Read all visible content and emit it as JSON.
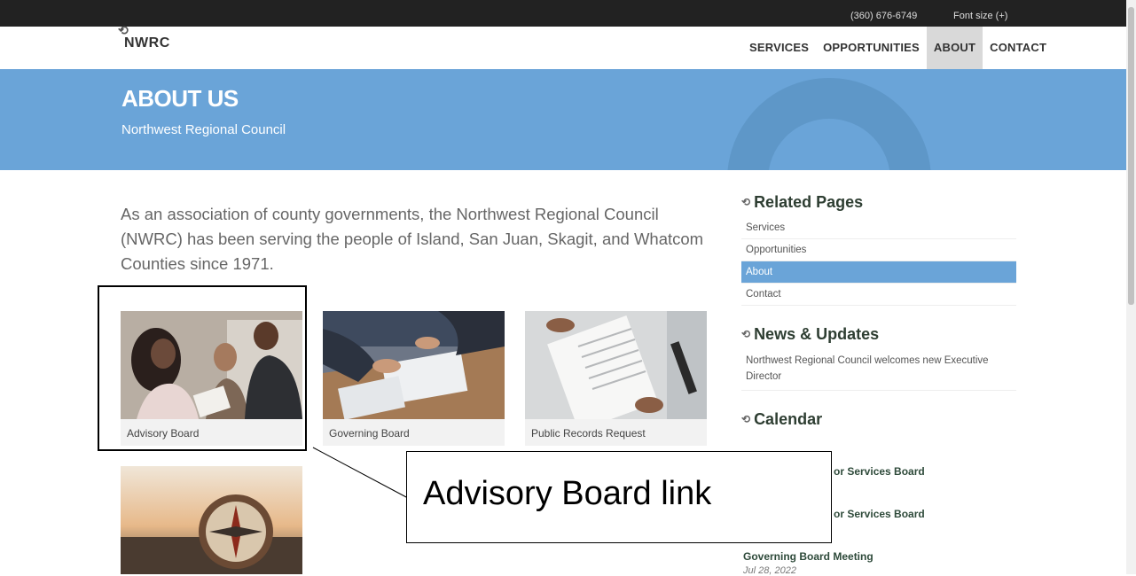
{
  "topbar": {
    "phone": "(360) 676-6749",
    "font_size": "Font size (+)"
  },
  "logo": {
    "text": "NWRC"
  },
  "nav": {
    "items": [
      "SERVICES",
      "OPPORTUNITIES",
      "ABOUT",
      "CONTACT"
    ],
    "active": "ABOUT"
  },
  "hero": {
    "title": "ABOUT US",
    "subtitle": "Northwest Regional Council"
  },
  "intro": "As an association of county governments, the Northwest Regional Council (NWRC) has been serving the people of Island, San Juan, Skagit, and Whatcom Counties since 1971.",
  "cards": [
    {
      "caption": "Advisory Board"
    },
    {
      "caption": "Governing Board"
    },
    {
      "caption": "Public Records Request"
    },
    {
      "caption": ""
    }
  ],
  "sidebar": {
    "related_title": "Related Pages",
    "related_links": [
      "Services",
      "Opportunities",
      "About",
      "Contact"
    ],
    "news_title": "News & Updates",
    "news_item": "Northwest Regional Council welcomes new Executive Director",
    "calendar_title": "Calendar",
    "calendar_items": [
      {
        "title": "or Services Board",
        "date": ""
      },
      {
        "title": "or Services Board",
        "date": ""
      },
      {
        "title": "Governing Board Meeting",
        "date": "Jul 28, 2022"
      }
    ]
  },
  "annotation": {
    "label": "Advisory Board link"
  },
  "colors": {
    "accent": "#6aa4d8",
    "topbar": "#222222",
    "heading": "#2e3e32"
  }
}
